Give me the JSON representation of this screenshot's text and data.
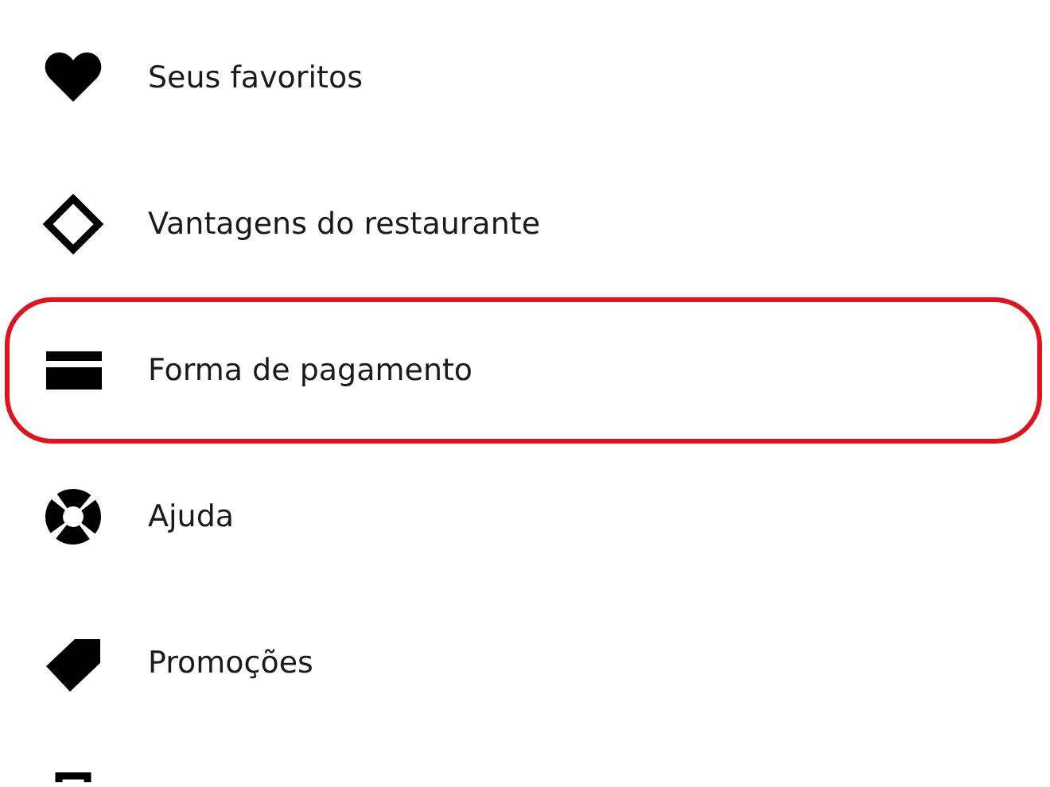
{
  "menu_items": [
    {
      "label": "Seus favoritos",
      "highlighted": false
    },
    {
      "label": "Vantagens do restaurante",
      "highlighted": false
    },
    {
      "label": "Forma de pagamento",
      "highlighted": true
    },
    {
      "label": "Ajuda",
      "highlighted": false
    },
    {
      "label": "Promoções",
      "highlighted": false
    }
  ]
}
